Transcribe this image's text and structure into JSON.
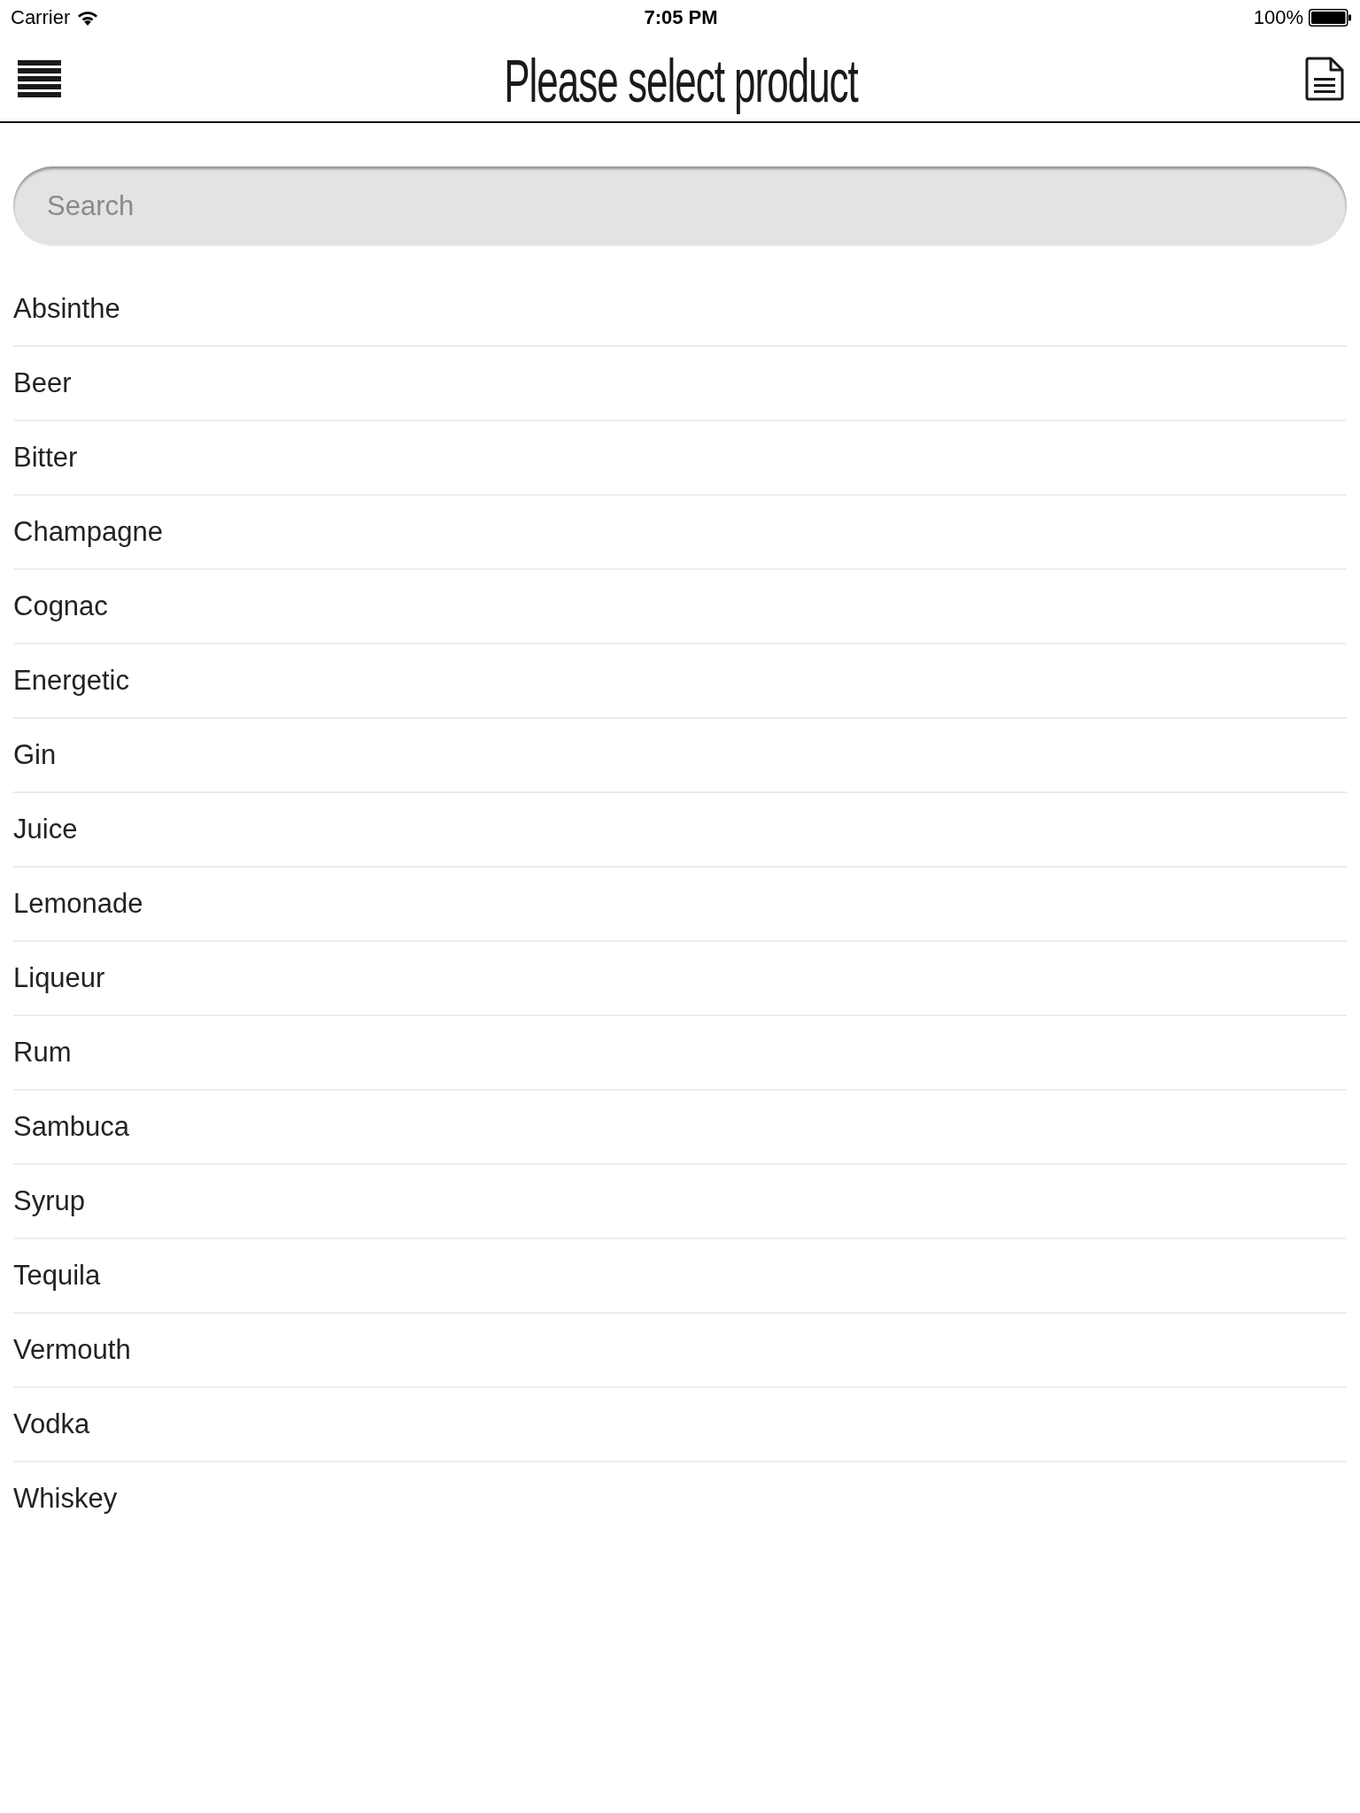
{
  "status_bar": {
    "carrier": "Carrier",
    "time": "7:05 PM",
    "battery": "100%"
  },
  "header": {
    "title": "Please select product"
  },
  "search": {
    "placeholder": "Search"
  },
  "products": [
    "Absinthe",
    "Beer",
    "Bitter",
    "Champagne",
    "Cognac",
    "Energetic",
    "Gin",
    "Juice",
    "Lemonade",
    "Liqueur",
    "Rum",
    "Sambuca",
    "Syrup",
    "Tequila",
    "Vermouth",
    "Vodka",
    "Whiskey"
  ]
}
